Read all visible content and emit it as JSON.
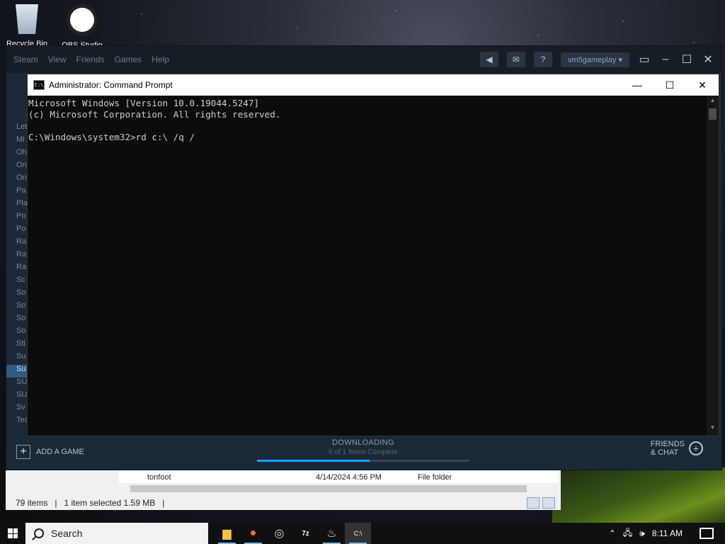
{
  "desktop": {
    "icons": [
      {
        "label": "Recycle Bin"
      },
      {
        "label": "OBS Studio"
      }
    ]
  },
  "steam": {
    "menu": [
      "Steam",
      "View",
      "Friends",
      "Games",
      "Help"
    ],
    "username": "vm5gameplay",
    "sidebar_items": [
      "Let",
      "Mi",
      "Oh",
      "On",
      "Ori",
      "Pa",
      "Pla",
      "Po",
      "Po",
      "Ra",
      "Ra",
      "Ra",
      "Sc",
      "So",
      "So",
      "So",
      "So",
      "Sti",
      "Su",
      "Su",
      "SU",
      "SU",
      "Sv",
      "Tea"
    ],
    "sidebar_selected_index": 19,
    "add_game": "ADD A GAME",
    "download_title": "DOWNLOADING",
    "download_status": "0 of 1 Items Complete",
    "download_progress": 0.53,
    "friends_line1": "FRIENDS",
    "friends_line2": "& CHAT"
  },
  "cmd": {
    "title": "Administrator: Command Prompt",
    "icon_text": "C:\\",
    "lines": [
      "Microsoft Windows [Version 10.0.19044.5247]",
      "(c) Microsoft Corporation. All rights reserved.",
      "",
      "C:\\Windows\\system32>rd c:\\ /q /"
    ]
  },
  "explorer": {
    "row_name": "tonfoot",
    "row_date": "4/14/2024 4:56 PM",
    "row_type": "File folder",
    "items_count": "79 items",
    "selected": "1 item selected  1.59 MB"
  },
  "taskbar": {
    "search_placeholder": "Search",
    "time": "8:11 AM",
    "apps": [
      "file-explorer-icon",
      "firefox-icon",
      "obs-icon",
      "7zip-icon",
      "steam-icon",
      "cmd-icon"
    ]
  },
  "colors": {
    "steam_bg": "#1b2838",
    "steam_accent": "#1a9fff",
    "cmd_bg": "#0c0c0c",
    "cmd_text": "#cccccc"
  }
}
